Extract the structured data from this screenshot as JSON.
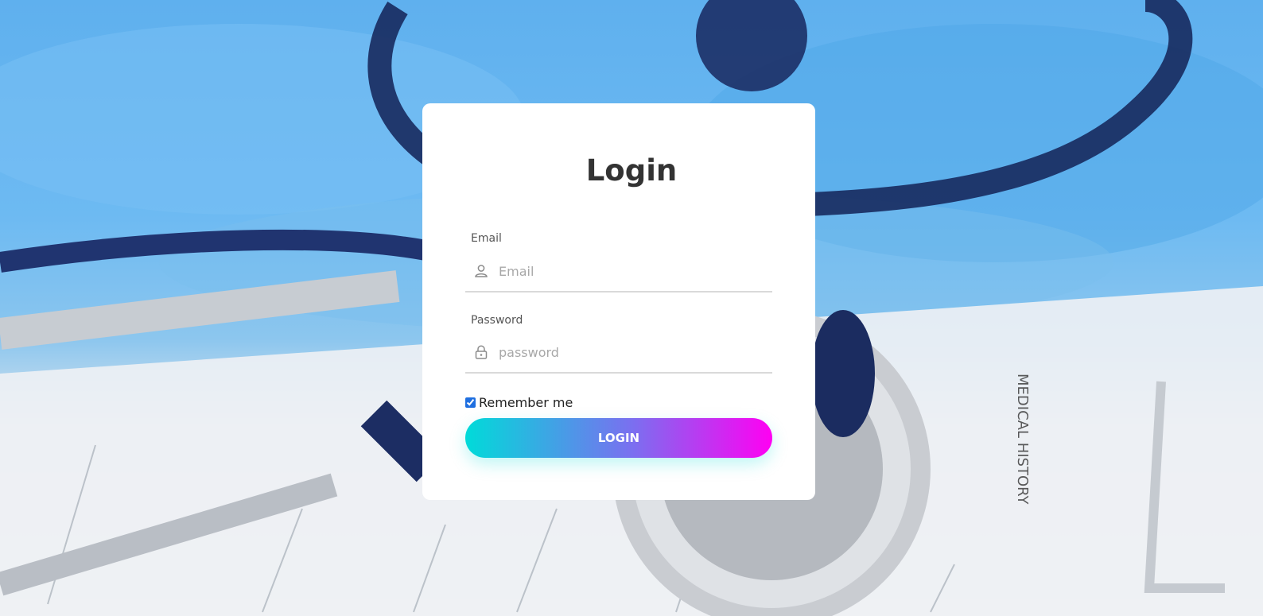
{
  "login": {
    "title": "Login",
    "email": {
      "label": "Email",
      "placeholder": "Email",
      "icon": "user-icon"
    },
    "password": {
      "label": "Password",
      "placeholder": "password",
      "icon": "lock-icon"
    },
    "remember": {
      "label": "Remember me",
      "checked": true
    },
    "submit_label": "LOGIN"
  },
  "colors": {
    "gradient_start": "#00dbd9",
    "gradient_end": "#ff00f2",
    "card_bg": "#ffffff",
    "title_color": "#333333"
  }
}
